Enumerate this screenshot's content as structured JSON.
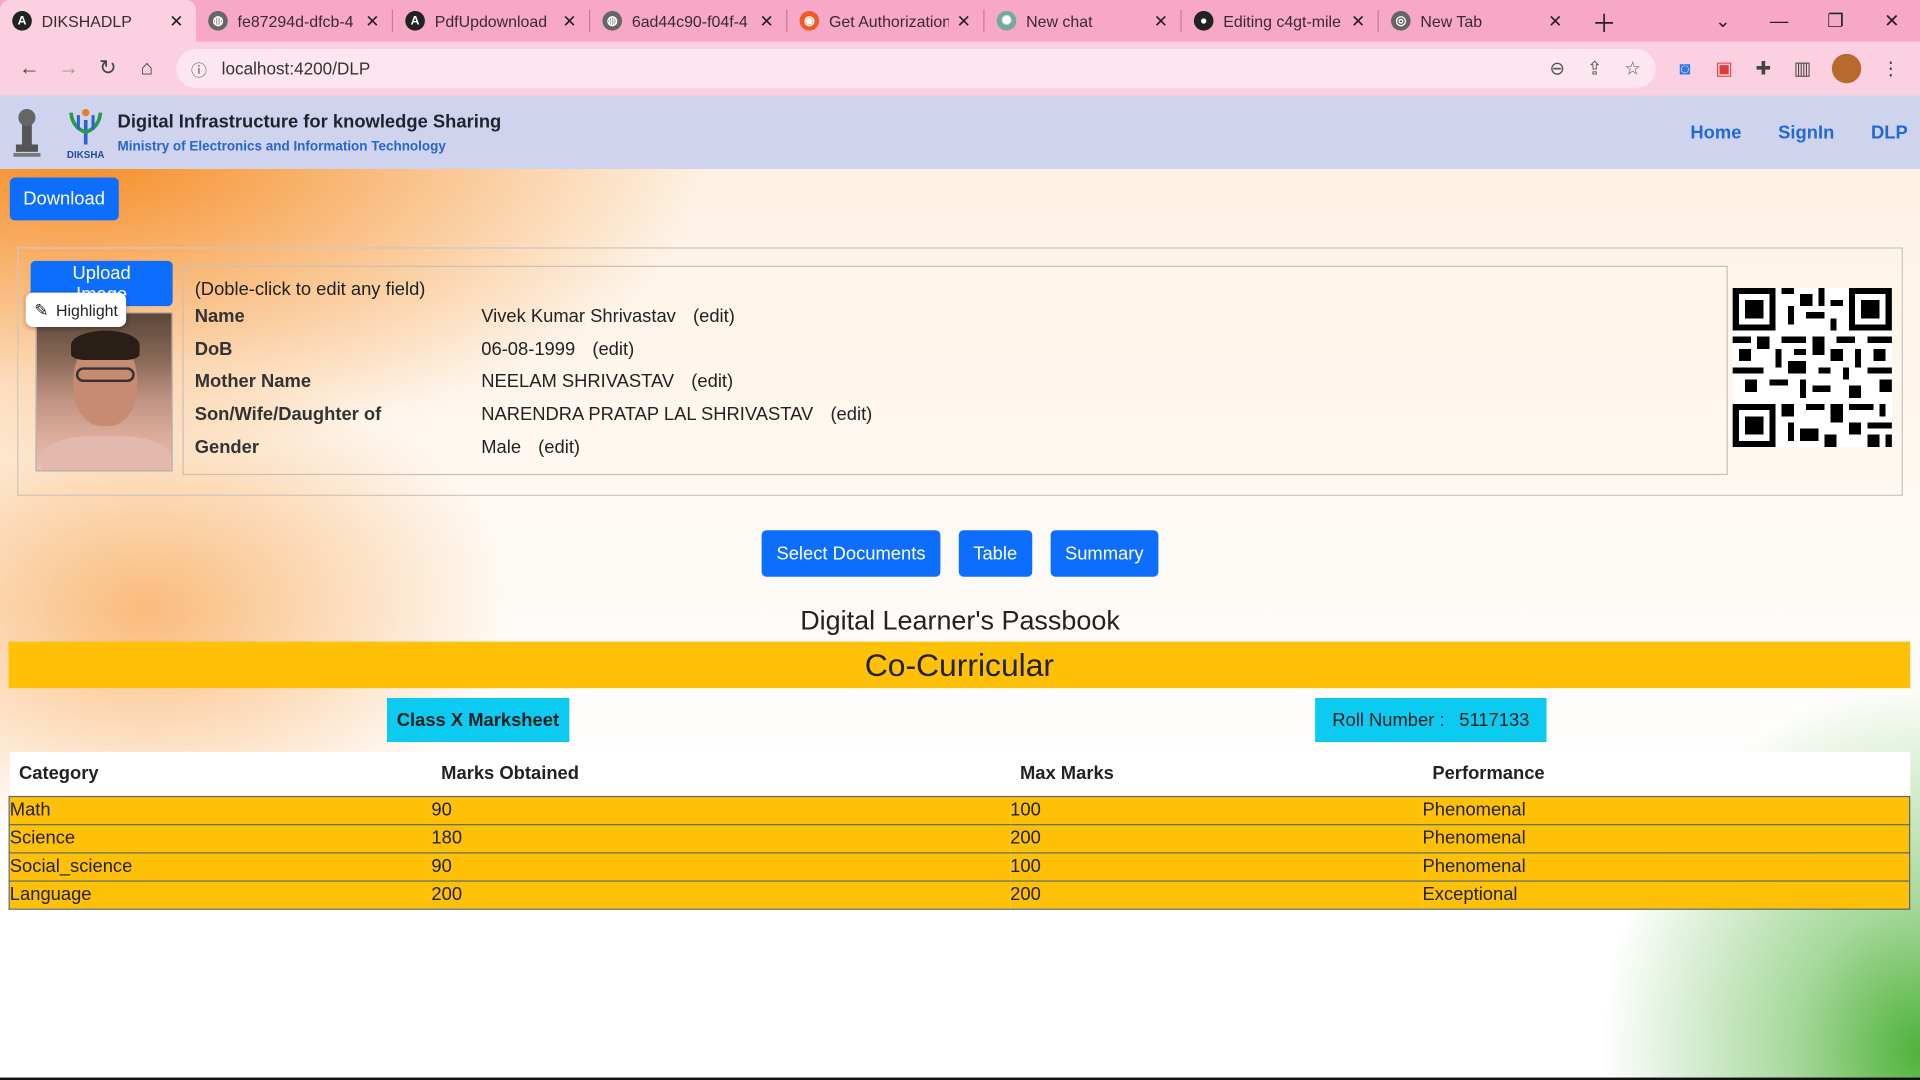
{
  "browser": {
    "tabs": [
      {
        "label": "DIKSHADLP",
        "icon": "angular-icon",
        "icon_color": "#222222",
        "active": true
      },
      {
        "label": "fe87294d-dfcb-4",
        "icon": "globe-icon",
        "icon_color": "#555555"
      },
      {
        "label": "PdfUpdownload",
        "icon": "angular-icon",
        "icon_color": "#222222"
      },
      {
        "label": "6ad44c90-f04f-4",
        "icon": "globe-icon",
        "icon_color": "#555555"
      },
      {
        "label": "Get Authorization",
        "icon": "postman-icon",
        "icon_color": "#ef5b25"
      },
      {
        "label": "New chat",
        "icon": "chatgpt-icon",
        "icon_color": "#74aa9c"
      },
      {
        "label": "Editing c4gt-mile",
        "icon": "github-icon",
        "icon_color": "#222222"
      },
      {
        "label": "New Tab",
        "icon": "chrome-icon",
        "icon_color": "#555555"
      }
    ],
    "url": "localhost:4200/DLP"
  },
  "header": {
    "title": "Digital Infrastructure for knowledge Sharing",
    "subtitle": "Ministry of Electronics and Information Technology",
    "logo_text": "DIKSHA",
    "nav": [
      "Home",
      "SignIn",
      "DLP"
    ]
  },
  "download_label": "Download",
  "profile": {
    "upload_label": "Upload Image",
    "highlight_label": "Highlight",
    "hint": "(Doble-click to edit any field)",
    "edit_label": "(edit)",
    "fields": [
      {
        "label": "Name",
        "value": "Vivek Kumar Shrivastav"
      },
      {
        "label": "DoB",
        "value": "06-08-1999"
      },
      {
        "label": "Mother Name",
        "value": "NEELAM SHRIVASTAV"
      },
      {
        "label": "Son/Wife/Daughter of",
        "value": "NARENDRA PRATAP LAL SHRIVASTAV"
      },
      {
        "label": "Gender",
        "value": "Male"
      }
    ]
  },
  "actions": [
    "Select Documents",
    "Table",
    "Summary"
  ],
  "passbook_title": "Digital Learner's Passbook",
  "section_title": "Co-Curricular",
  "marksheet_label": "Class X Marksheet",
  "roll": {
    "label": "Roll Number :",
    "value": "5117133"
  },
  "table": {
    "headers": [
      "Category",
      "Marks Obtained",
      "Max Marks",
      "Performance"
    ],
    "rows": [
      [
        "Math",
        "90",
        "100",
        "Phenomenal"
      ],
      [
        "Science",
        "180",
        "200",
        "Phenomenal"
      ],
      [
        "Social_science",
        "90",
        "100",
        "Phenomenal"
      ],
      [
        "Language",
        "200",
        "200",
        "Exceptional"
      ]
    ]
  },
  "colors": {
    "primary": "#0d6efd",
    "warning": "#ffc107",
    "info": "#0dcaf0",
    "header_bg": "#cfd3ee"
  }
}
